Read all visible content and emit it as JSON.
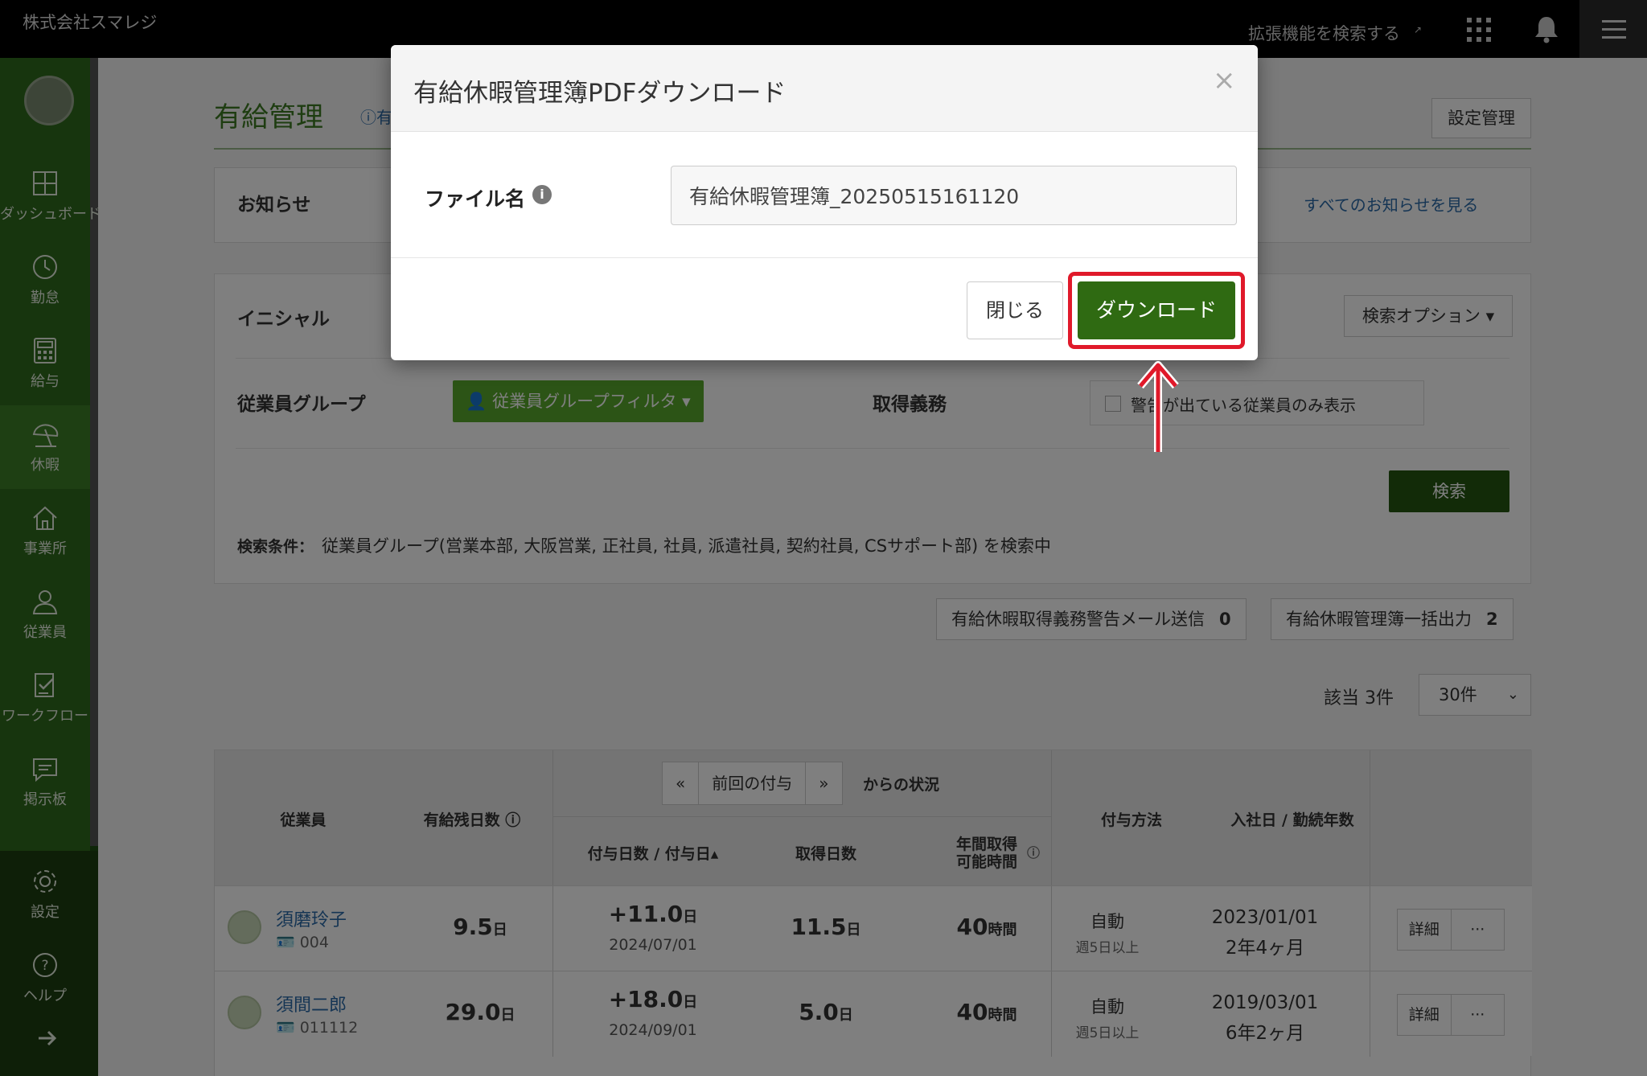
{
  "topbar": {
    "company": "株式会社スマレジ",
    "extension_search": "拡張機能を検索する",
    "extension_icon": "external-link-icon",
    "apps_icon": "apps-grid-icon",
    "bell_icon": "bell-icon",
    "menu_icon": "hamburger-menu-icon"
  },
  "sidebar": {
    "items": [
      {
        "label": "ダッシュボード",
        "icon": "dashboard-icon"
      },
      {
        "label": "勤怠",
        "icon": "clock-icon"
      },
      {
        "label": "給与",
        "icon": "calculator-icon"
      },
      {
        "label": "休暇",
        "icon": "beach-umbrella-icon"
      },
      {
        "label": "事業所",
        "icon": "home-icon"
      },
      {
        "label": "従業員",
        "icon": "person-icon"
      },
      {
        "label": "ワークフロー",
        "icon": "checklist-icon"
      },
      {
        "label": "掲示板",
        "icon": "chat-icon"
      },
      {
        "label": "設定",
        "icon": "gear-icon"
      },
      {
        "label": "ヘルプ",
        "icon": "help-icon"
      }
    ],
    "active": "休暇",
    "collapse_icon": "arrow-right-icon"
  },
  "main": {
    "title": "有給管理",
    "help_link": "有",
    "settings_button": "設定管理",
    "notice": {
      "heading": "お知らせ",
      "view_all": "すべてのお知らせを見る"
    },
    "search": {
      "initial_label": "イニシャル",
      "options_button": "検索オプション",
      "group_label": "従業員グループ",
      "group_filter_button": "従業員グループフィルタ",
      "obligation_label": "取得義務",
      "warning_checkbox": "警告が出ている従業員のみ表示",
      "search_button": "検索",
      "conditions_label": "検索条件：",
      "conditions_text": "従業員グループ(営業本部, 大阪営業, 正社員, 社員, 派遣社員, 契約社員, CSサポート部) を検索中"
    },
    "actions": {
      "warning_mail": "有給休暇取得義務警告メール送信",
      "warning_mail_count": "0",
      "bulk_output": "有給休暇管理簿一括出力",
      "bulk_output_count": "2"
    },
    "result_count": "該当 3件",
    "per_page": "30件"
  },
  "table": {
    "headers": {
      "employee": "従業員",
      "remaining": "有給残日数",
      "pager_prev": "«",
      "pager_label": "前回の付与",
      "pager_next": "»",
      "since": "からの状況",
      "grant_days": "付与日数 / 付与日▴",
      "taken_days": "取得日数",
      "annual_hours_1": "年間取得",
      "annual_hours_2": "可能時間",
      "grant_method": "付与方法",
      "join_date": "入社日 / 勤続年数"
    },
    "rows": [
      {
        "name": "須磨玲子",
        "code": "004",
        "remaining": "9.5",
        "remaining_unit": "日",
        "grant": "+11.0",
        "grant_unit": "日",
        "grant_date": "2024/07/01",
        "taken": "11.5",
        "taken_unit": "日",
        "hours": "40",
        "hours_unit": "時間",
        "method": "自動",
        "method_sub": "週5日以上",
        "join": "2023/01/01",
        "tenure": "2年4ヶ月",
        "detail": "詳細",
        "more": "···"
      },
      {
        "name": "須間二郎",
        "code": "011112",
        "remaining": "29.0",
        "remaining_unit": "日",
        "grant": "+18.0",
        "grant_unit": "日",
        "grant_date": "2024/09/01",
        "taken": "5.0",
        "taken_unit": "日",
        "hours": "40",
        "hours_unit": "時間",
        "method": "自動",
        "method_sub": "週5日以上",
        "join": "2019/03/01",
        "tenure": "6年2ヶ月",
        "detail": "詳細",
        "more": "···"
      }
    ]
  },
  "modal": {
    "title": "有給休暇管理簿PDFダウンロード",
    "close_symbol": "×",
    "file_label": "ファイル名",
    "info_symbol": "i",
    "file_value": "有給休暇管理簿_20250515161120",
    "close_button": "閉じる",
    "download_button": "ダウンロード"
  },
  "colors": {
    "sidebar": "#2e6b1c",
    "primary_button": "#2f6a12",
    "highlight": "#e0192a",
    "link": "#2b6aa8"
  }
}
